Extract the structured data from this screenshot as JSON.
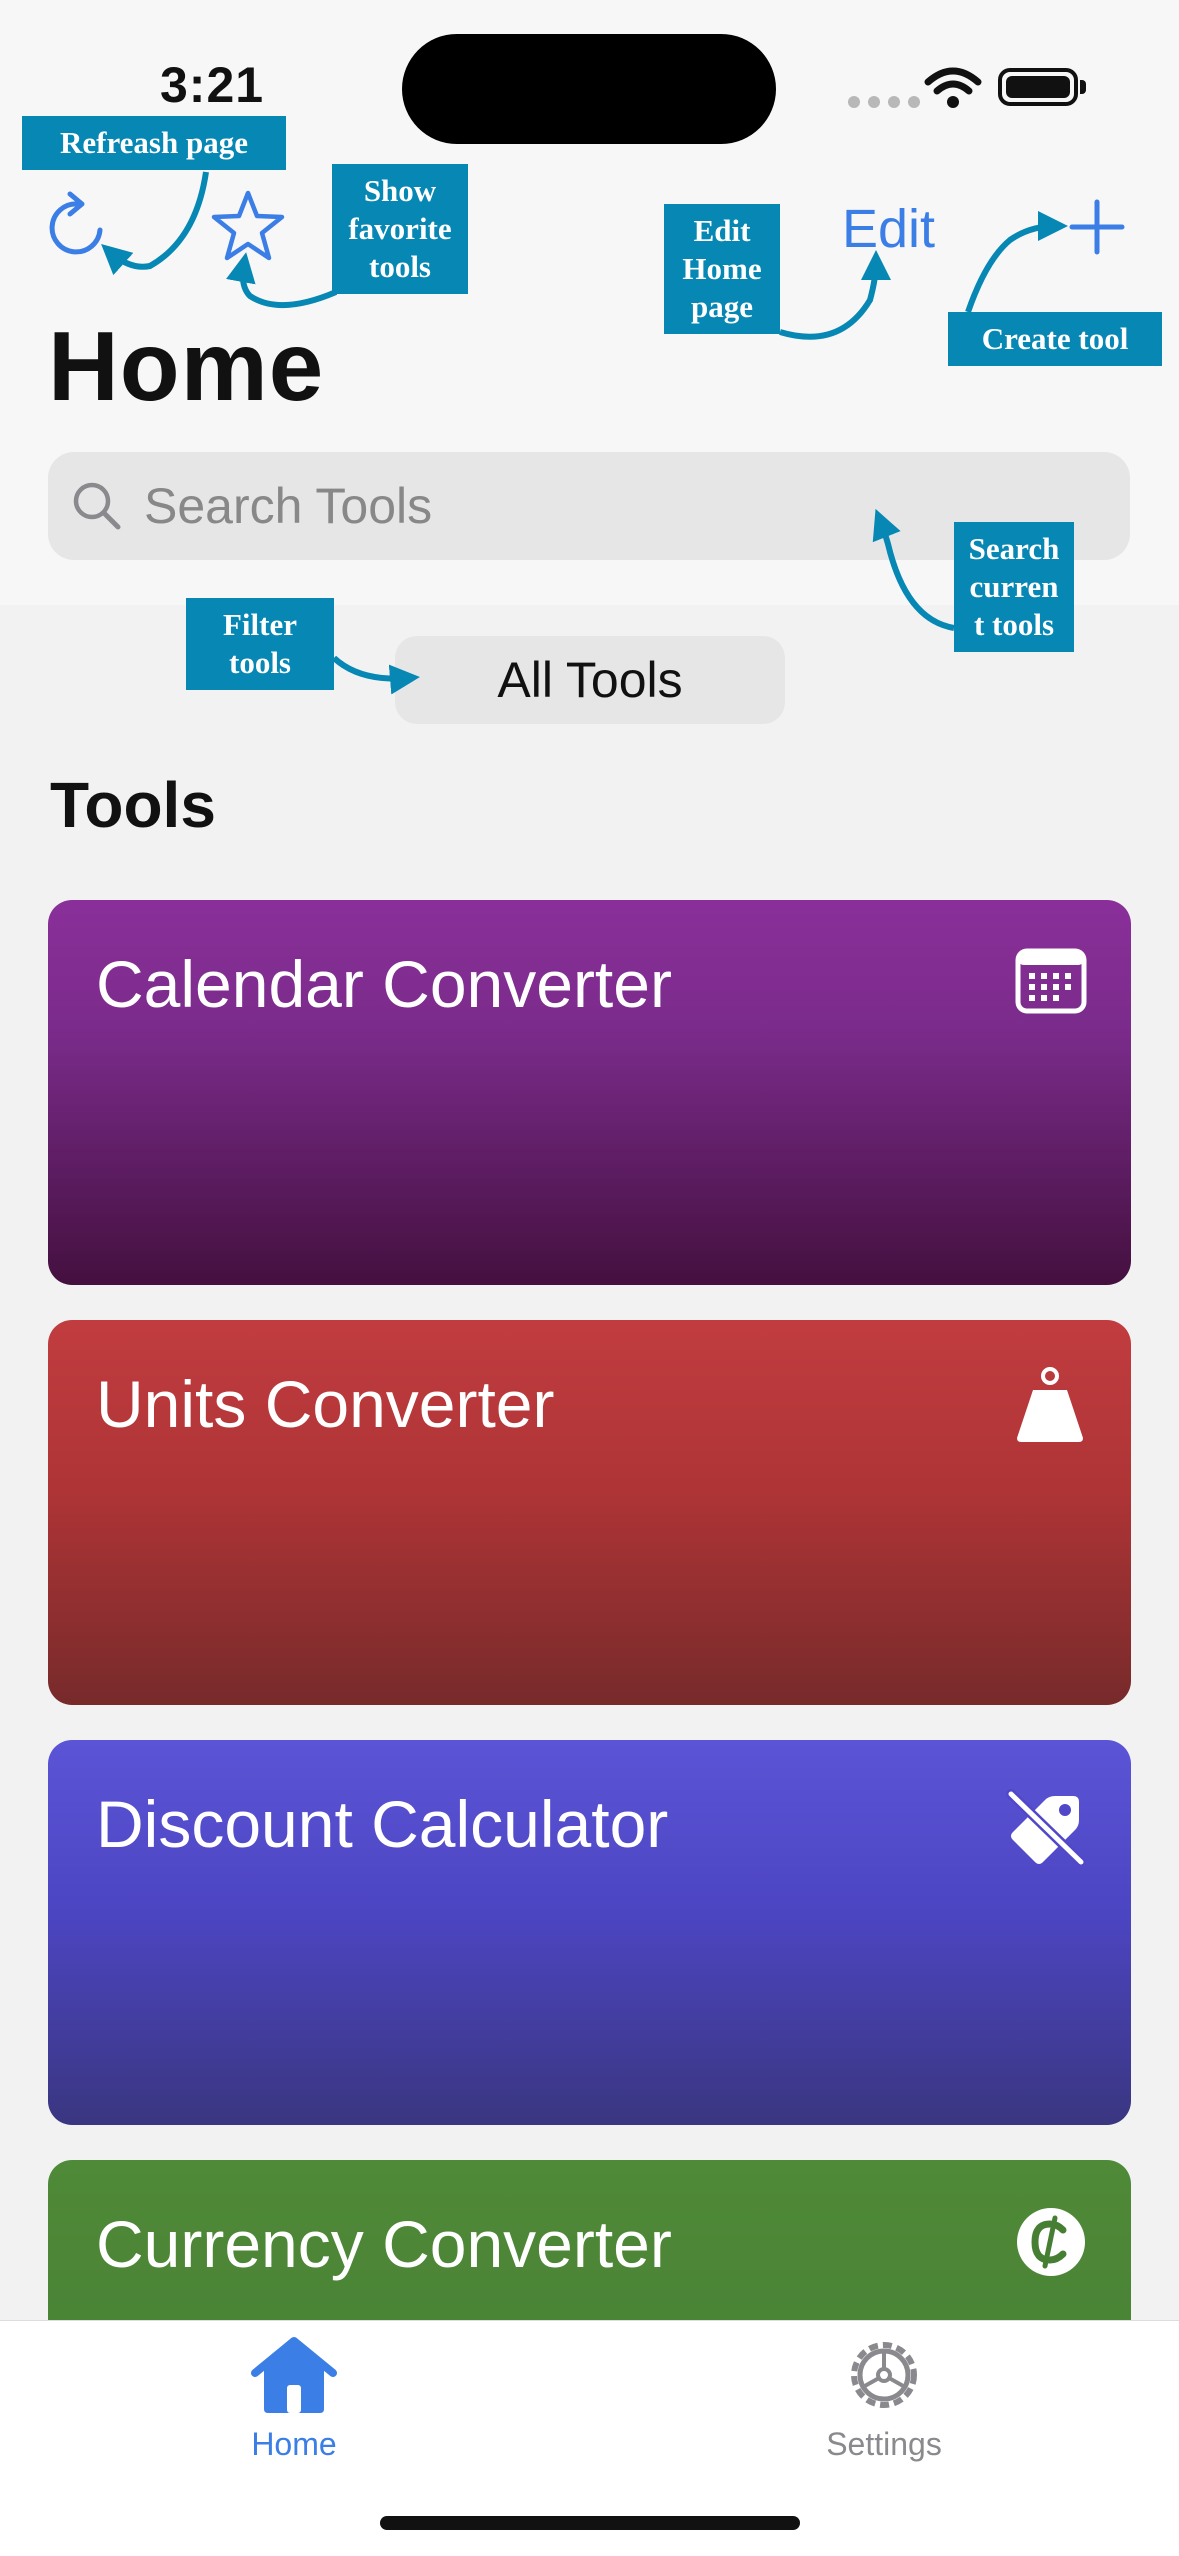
{
  "status_bar": {
    "time": "3:21"
  },
  "nav": {
    "edit_label": "Edit"
  },
  "page_title": "Home",
  "search": {
    "placeholder": "Search Tools"
  },
  "filter": {
    "selected": "All Tools"
  },
  "section_title": "Tools",
  "tools": [
    {
      "label": "Calendar Converter",
      "icon": "calendar-icon"
    },
    {
      "label": "Units Converter",
      "icon": "weight-icon"
    },
    {
      "label": "Discount Calculator",
      "icon": "tag-slash-icon"
    },
    {
      "label": "Currency Converter",
      "icon": "cedi-sign-icon"
    }
  ],
  "tabbar": {
    "home_label": "Home",
    "settings_label": "Settings"
  },
  "annotations": {
    "refresh": "Refreash page",
    "favorites": [
      "Show",
      "favorite",
      "tools"
    ],
    "edit": [
      "Edit",
      "Home",
      "page"
    ],
    "create": "Create tool",
    "search": [
      "Search",
      "curren",
      "t tools"
    ],
    "filter": [
      "Filter",
      "tools"
    ]
  },
  "colors": {
    "accent": "#3b7ee6",
    "annotation": "#0787b4",
    "calendar_card": "#8a2f9a",
    "units_card": "#c13c3f",
    "discount_card": "#5b54d6",
    "currency_card": "#4f8a38"
  }
}
